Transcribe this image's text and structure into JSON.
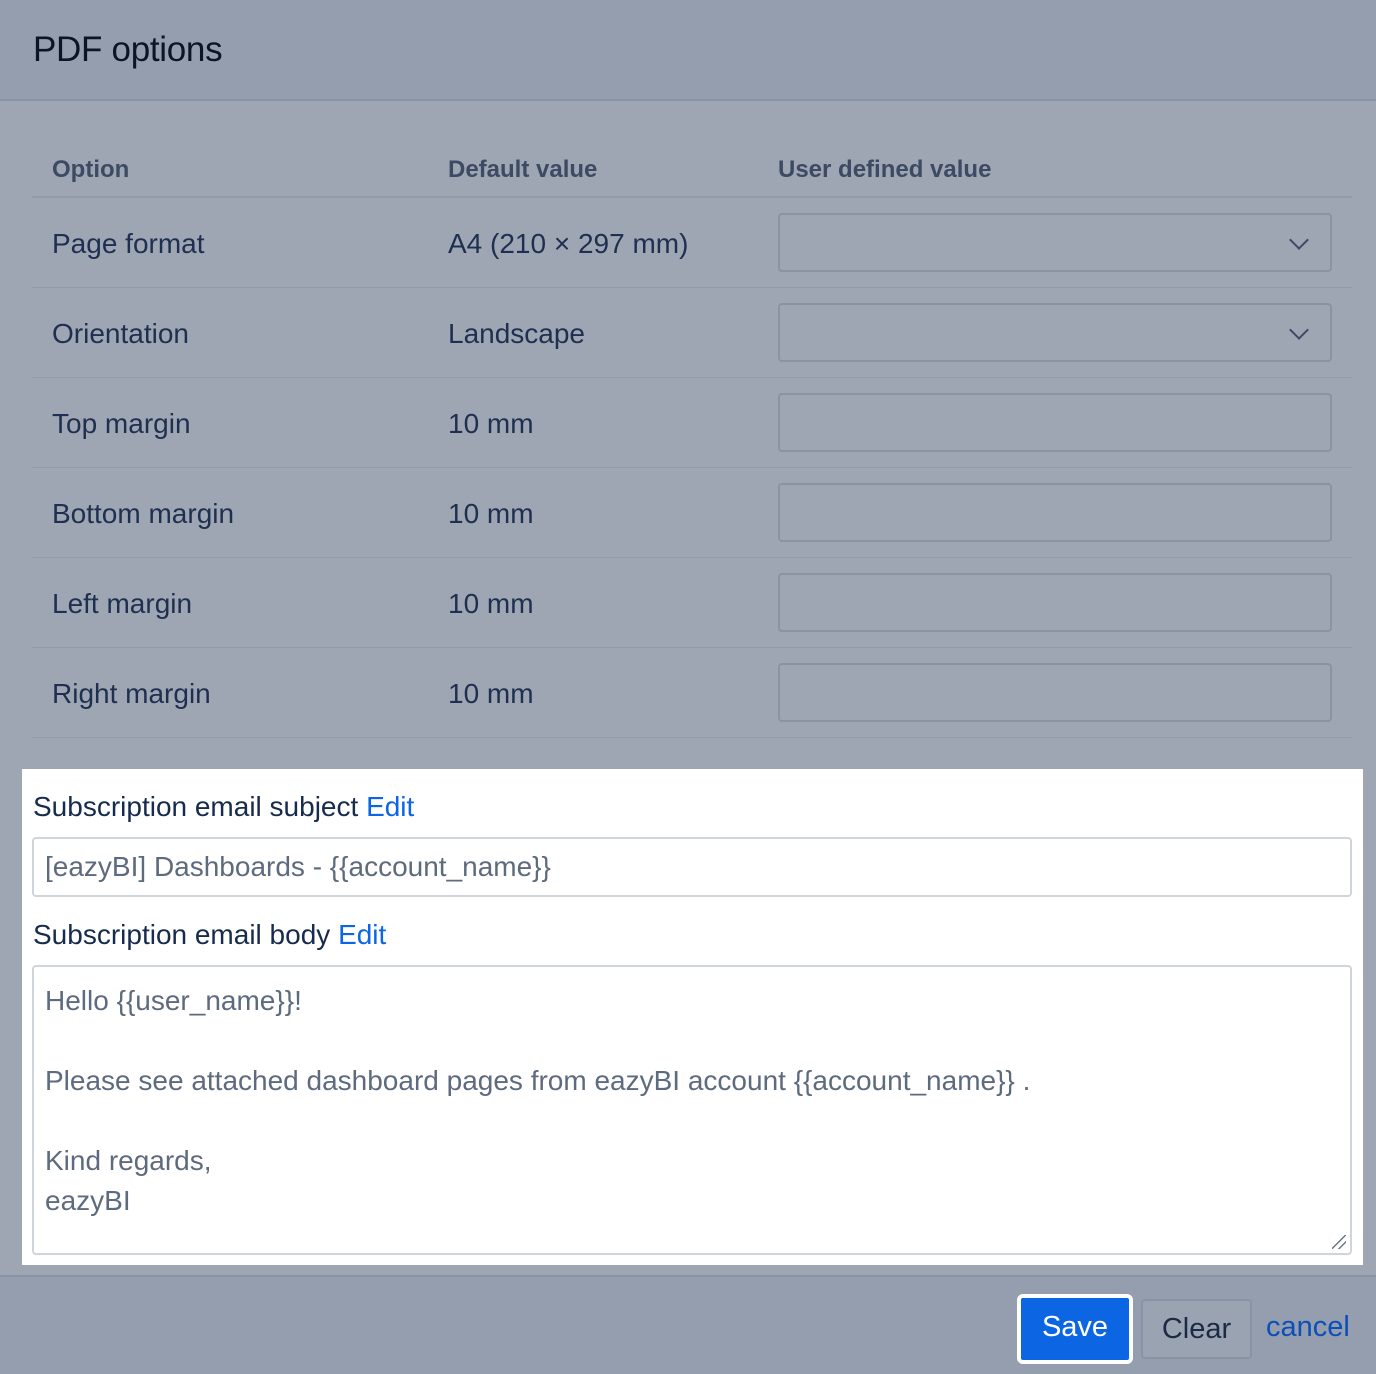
{
  "dialog": {
    "title": "PDF options"
  },
  "table": {
    "headers": [
      "Option",
      "Default value",
      "User defined value"
    ],
    "rows": [
      {
        "option": "Page format",
        "default": "A4 (210 × 297 mm)",
        "user_value": "",
        "control": "select"
      },
      {
        "option": "Orientation",
        "default": "Landscape",
        "user_value": "",
        "control": "select"
      },
      {
        "option": "Top margin",
        "default": "10 mm",
        "user_value": "",
        "control": "input"
      },
      {
        "option": "Bottom margin",
        "default": "10 mm",
        "user_value": "",
        "control": "input"
      },
      {
        "option": "Left margin",
        "default": "10 mm",
        "user_value": "",
        "control": "input"
      },
      {
        "option": "Right margin",
        "default": "10 mm",
        "user_value": "",
        "control": "input"
      }
    ]
  },
  "email": {
    "subject_label": "Subscription email subject",
    "subject_edit": "Edit",
    "subject_value": "[eazyBI] Dashboards - {{account_name}}",
    "body_label": "Subscription email body",
    "body_edit": "Edit",
    "body_lines": [
      "Hello {{user_name}}!",
      "",
      "Please see attached dashboard pages from eazyBI account {{account_name}} .",
      "",
      "Kind regards,",
      "eazyBI"
    ]
  },
  "footer": {
    "save_label": "Save",
    "clear_label": "Clear",
    "cancel_label": "cancel"
  },
  "colors": {
    "accent": "#0c66e4",
    "overlay": "#9ea6b4",
    "panel": "#ffffff"
  },
  "icons": {
    "select_arrow": "chevron-down-icon",
    "resize": "resize-handle-icon"
  }
}
